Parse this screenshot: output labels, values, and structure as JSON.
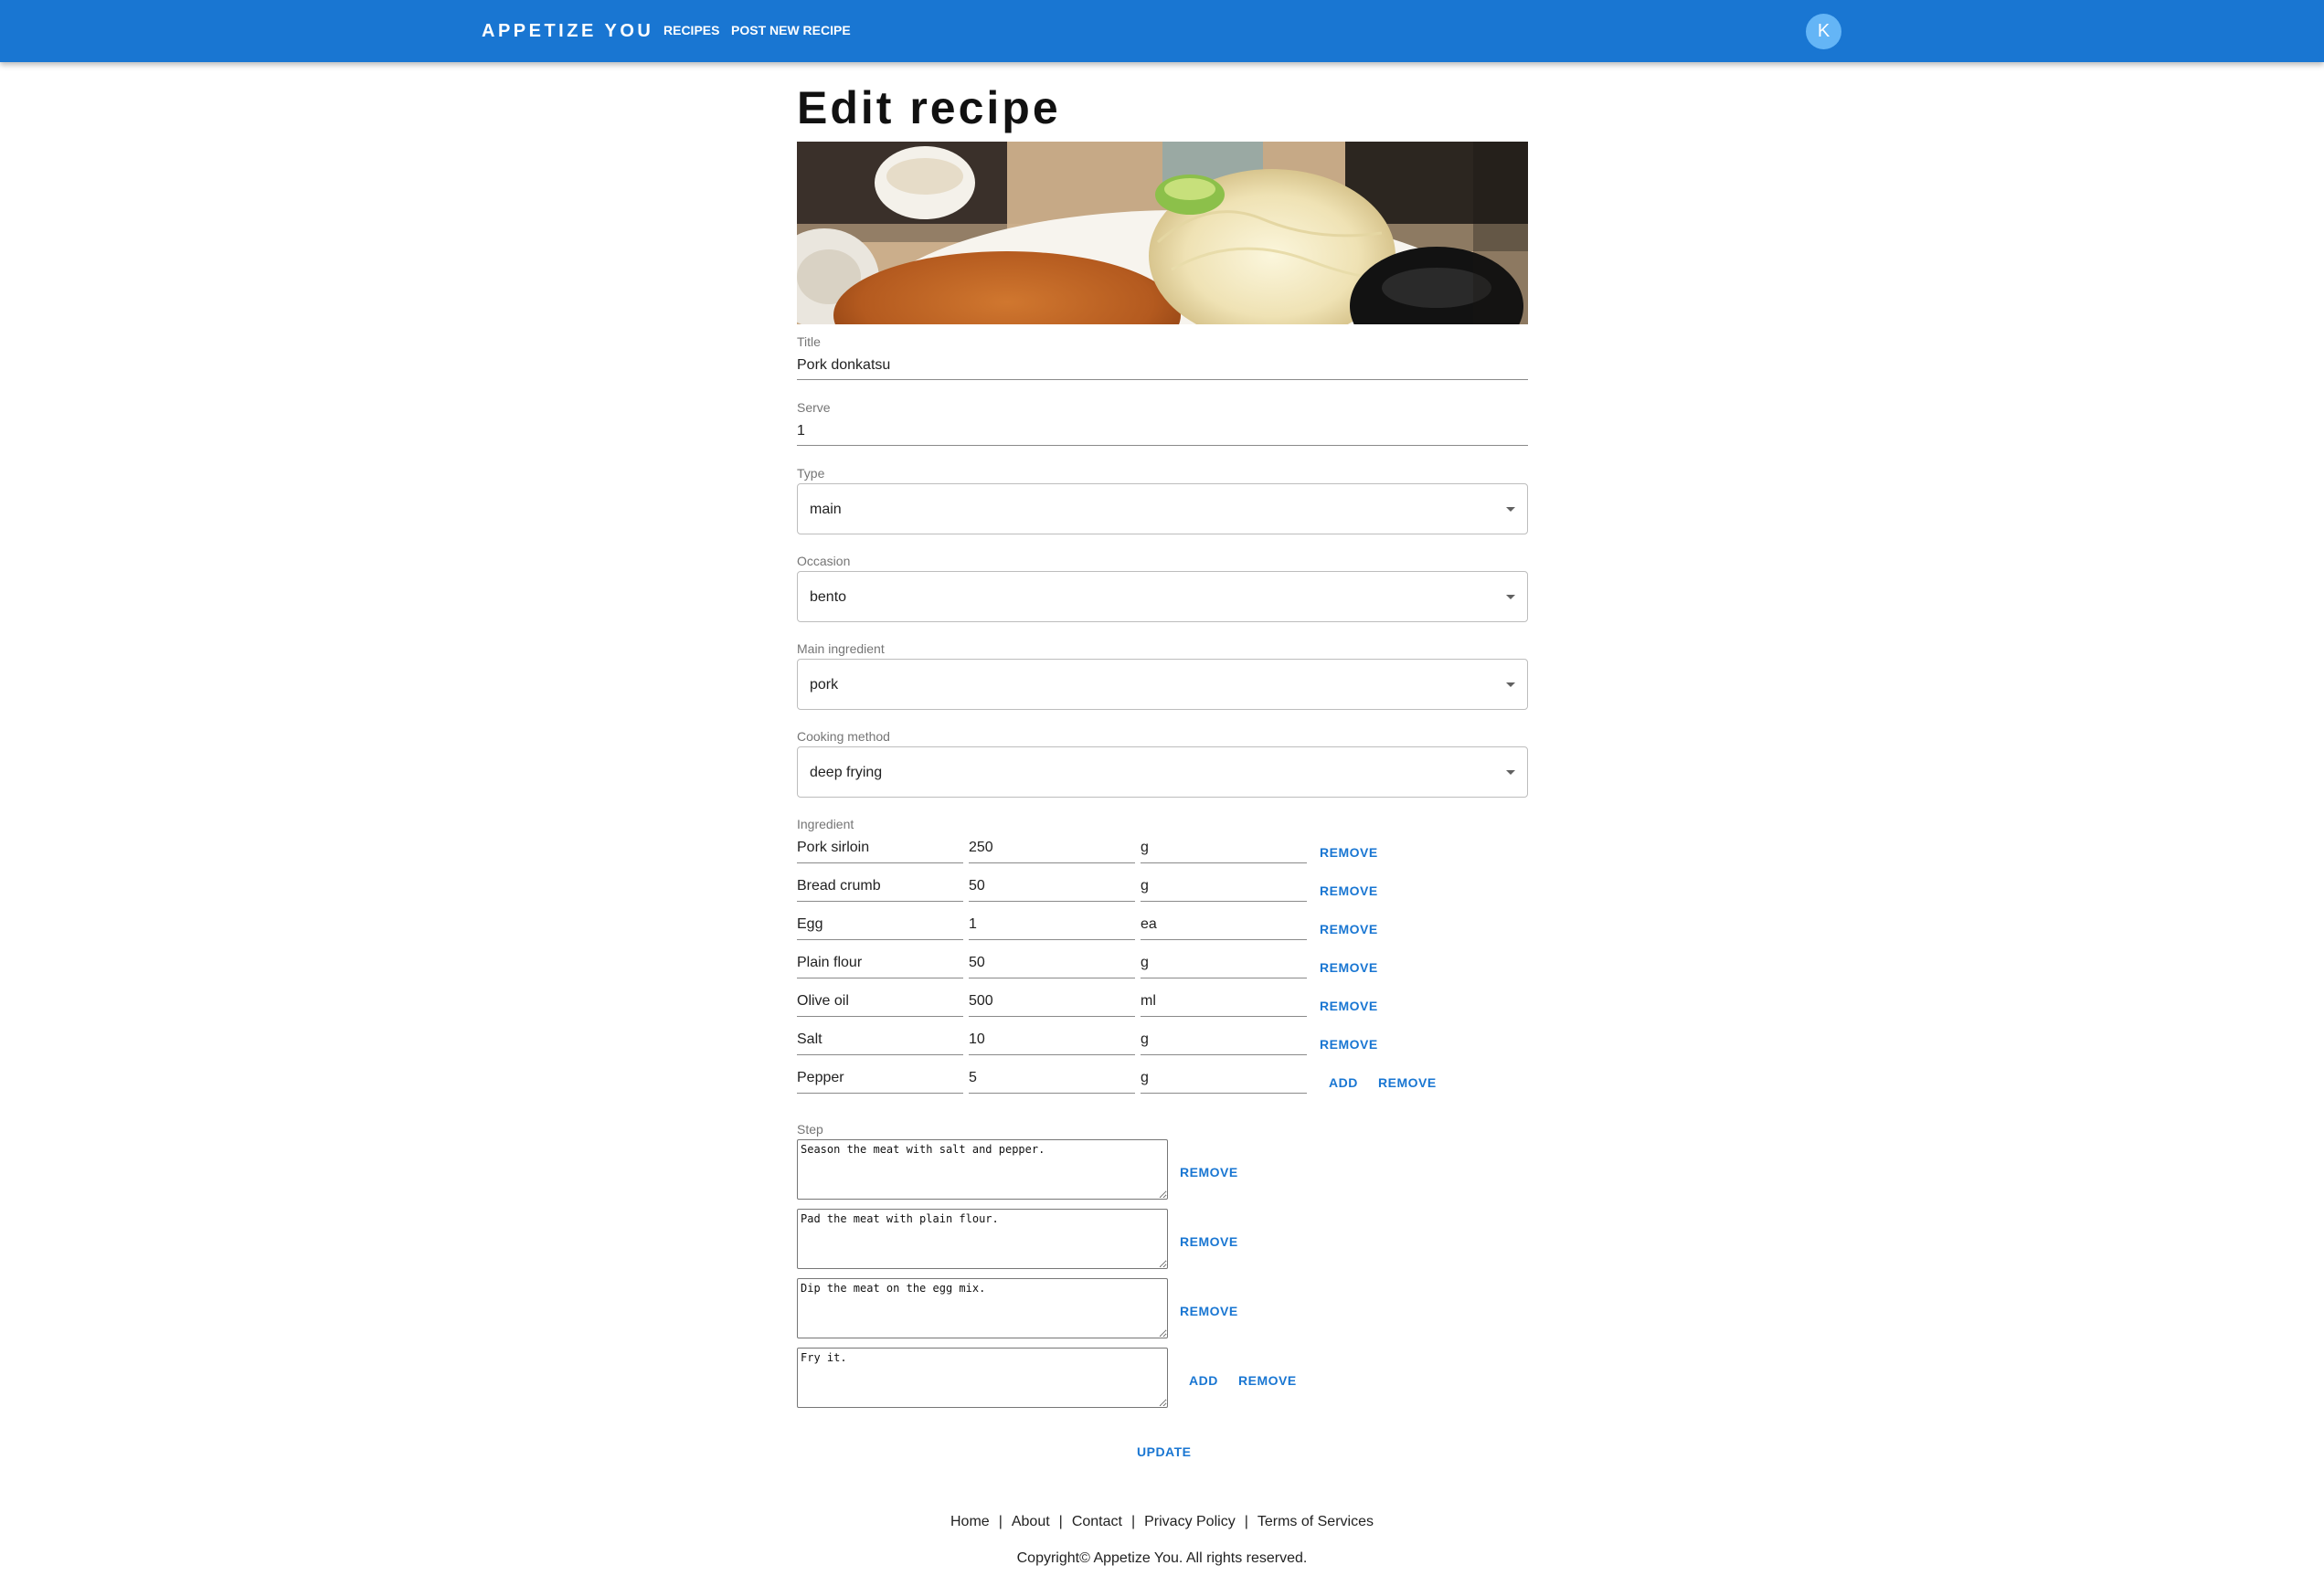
{
  "app": {
    "brand": "APPETIZE YOU",
    "nav": {
      "recipes": "RECIPES",
      "post_new": "POST NEW RECIPE"
    },
    "avatar_initial": "K",
    "accent_color": "#1976d2"
  },
  "page": {
    "title": "Edit recipe"
  },
  "form": {
    "title": {
      "label": "Title",
      "value": "Pork donkatsu"
    },
    "serve": {
      "label": "Serve",
      "value": "1"
    },
    "type": {
      "label": "Type",
      "value": "main"
    },
    "occasion": {
      "label": "Occasion",
      "value": "bento"
    },
    "main_ingredient": {
      "label": "Main ingredient",
      "value": "pork"
    },
    "cooking_method": {
      "label": "Cooking method",
      "value": "deep frying"
    },
    "ingredient_label": "Ingredient",
    "ingredients": [
      {
        "name": "Pork sirloin",
        "qty": "250",
        "unit": "g"
      },
      {
        "name": "Bread crumb",
        "qty": "50",
        "unit": "g"
      },
      {
        "name": "Egg",
        "qty": "1",
        "unit": "ea"
      },
      {
        "name": "Plain flour",
        "qty": "50",
        "unit": "g"
      },
      {
        "name": "Olive oil",
        "qty": "500",
        "unit": "ml"
      },
      {
        "name": "Salt",
        "qty": "10",
        "unit": "g"
      },
      {
        "name": "Pepper",
        "qty": "5",
        "unit": "g"
      }
    ],
    "step_label": "Step",
    "steps": [
      "Season the meat with salt and pepper.",
      "Pad the meat with plain flour.",
      "Dip the meat on the egg mix.",
      "Fry it."
    ],
    "add_label": "ADD",
    "remove_label": "REMOVE",
    "update_label": "UPDATE"
  },
  "footer": {
    "links": [
      "Home",
      "About",
      "Contact",
      "Privacy Policy",
      "Terms of Services"
    ],
    "separator": "|",
    "copyright": "Copyright© Appetize You. All rights reserved."
  }
}
